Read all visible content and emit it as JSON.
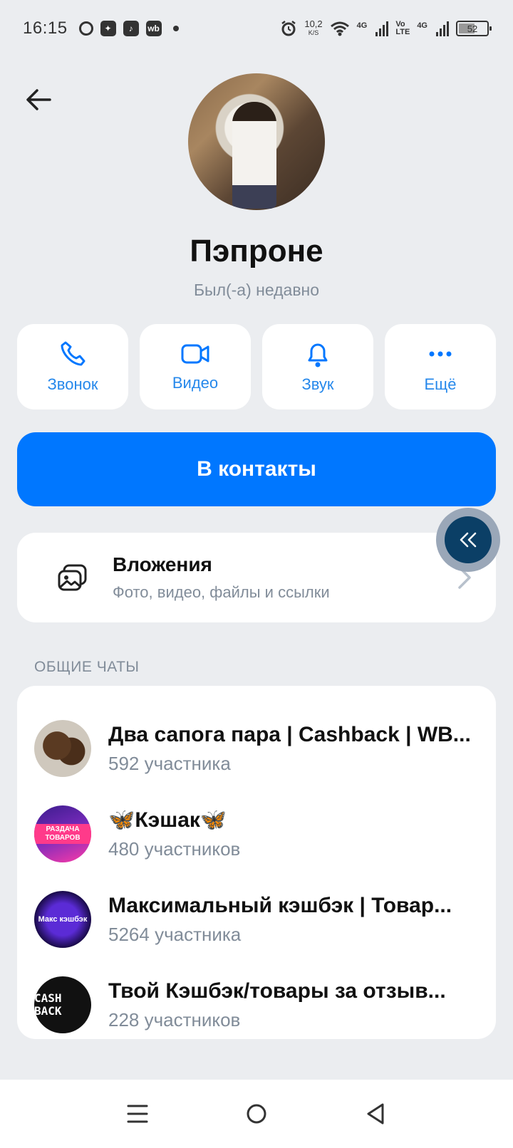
{
  "status_bar": {
    "time": "16:15",
    "app_icons": [
      "chat-bubble-icon",
      "bird-icon",
      "music-icon",
      "wb-icon"
    ],
    "wb_label": "wb",
    "net_speed": "10,2",
    "net_speed_unit": "K/S",
    "net_type_1": "4G",
    "net_type_2": "4G",
    "volte_top": "Vo",
    "volte_bottom": "LTE",
    "battery": "52"
  },
  "profile": {
    "name": "Пэпроне",
    "status": "Был(-а) недавно"
  },
  "actions": [
    {
      "label": "Звонок",
      "icon": "phone-icon"
    },
    {
      "label": "Видео",
      "icon": "video-icon"
    },
    {
      "label": "Звук",
      "icon": "bell-icon"
    },
    {
      "label": "Ещё",
      "icon": "more-icon"
    }
  ],
  "add_contact_label": "В контакты",
  "attachments": {
    "title": "Вложения",
    "subtitle": "Фото, видео, файлы и ссылки"
  },
  "common_chats": {
    "header": "ОБЩИЕ ЧАТЫ",
    "items": [
      {
        "title": "Два сапога пара | Cashback | WB...",
        "members": "592 участника",
        "avatar_text": ""
      },
      {
        "title": "🦋Кэшак🦋",
        "members": "480 участников",
        "avatar_text": "РАЗДАЧА ТОВАРОВ"
      },
      {
        "title": "Максимальный кэшбэк | Товар...",
        "members": "5264 участника",
        "avatar_text": "Макс кэшбэк"
      },
      {
        "title": "Твой Кэшбэк/товары за отзыв...",
        "members": "228 участников",
        "avatar_text": "CASH BACK"
      }
    ]
  },
  "colors": {
    "accent": "#0077ff",
    "accent_text": "#2688eb",
    "background": "#ebedf0",
    "secondary_text": "#818c99",
    "float_button": "#0b3f66"
  }
}
